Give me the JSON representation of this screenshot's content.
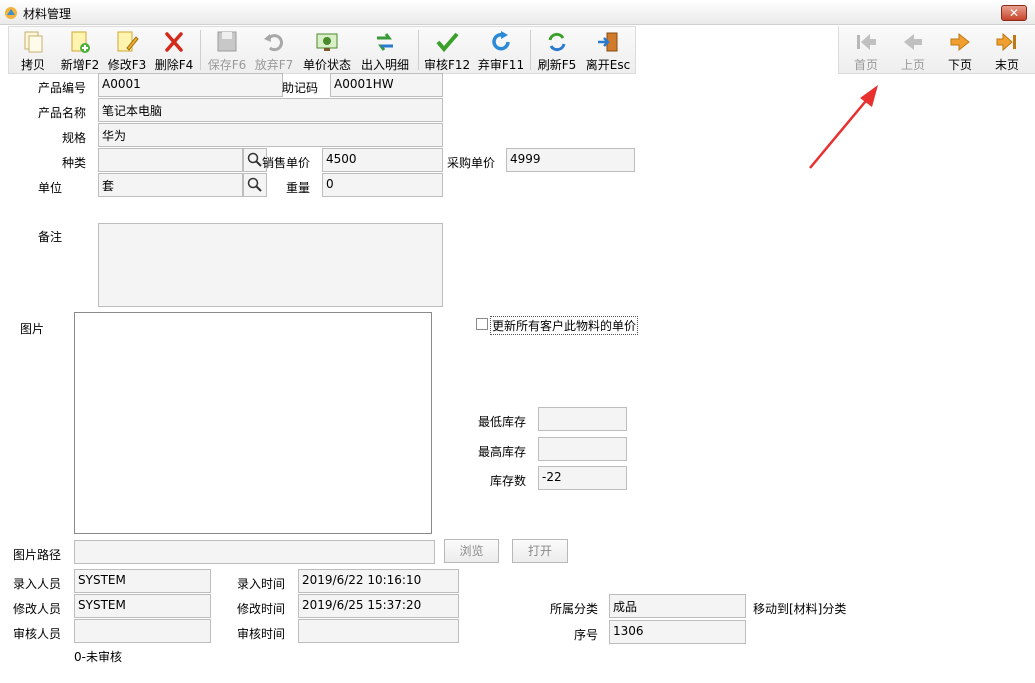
{
  "window": {
    "title": "材料管理",
    "close_label": "✕"
  },
  "toolbar": {
    "copy": "拷贝",
    "new": "新增F2",
    "edit": "修改F3",
    "delete": "删除F4",
    "save": "保存F6",
    "discard": "放弃F7",
    "price_status": "单价状态",
    "io_detail": "出入明细",
    "approve": "审核F12",
    "unapprove": "弃审F11",
    "refresh": "刷新F5",
    "exit": "离开Esc"
  },
  "nav": {
    "first": "首页",
    "prev": "上页",
    "next": "下页",
    "last": "末页"
  },
  "form": {
    "product_code_label": "产品编号",
    "product_code": "A0001",
    "helper_code_label": "助记码",
    "helper_code": "A0001HW",
    "product_name_label": "产品名称",
    "product_name": "笔记本电脑",
    "spec_label": "规格",
    "spec": "华为",
    "category_label": "种类",
    "category": "",
    "sale_price_label": "销售单价",
    "sale_price": "4500",
    "purchase_price_label": "采购单价",
    "purchase_price": "4999",
    "unit_label": "单位",
    "unit": "套",
    "weight_label": "重量",
    "weight": "0",
    "remark_label": "备注",
    "remark": "",
    "image_label": "图片",
    "update_price_checkbox_label": "更新所有客户此物料的单价",
    "min_stock_label": "最低库存",
    "min_stock": "",
    "max_stock_label": "最高库存",
    "max_stock": "",
    "stock_label": "库存数",
    "stock": "-22",
    "image_path_label": "图片路径",
    "image_path": "",
    "browse_button": "浏览",
    "open_button": "打开",
    "creator_label": "录入人员",
    "creator": "SYSTEM",
    "create_time_label": "录入时间",
    "create_time": "2019/6/22 10:16:10",
    "modifier_label": "修改人员",
    "modifier": "SYSTEM",
    "modify_time_label": "修改时间",
    "modify_time": "2019/6/25 15:37:20",
    "category_group_label": "所属分类",
    "category_group": "成品",
    "move_to_link": "移动到[材料]分类",
    "reviewer_label": "审核人员",
    "reviewer": "",
    "review_time_label": "审核时间",
    "review_time": "",
    "sequence_label": "序号",
    "sequence": "1306",
    "status_text": "0-未审核"
  },
  "colors": {
    "accent_arrow": "#e8302e",
    "nav_active": "#f0a030",
    "nav_disabled": "#b8b8b8"
  }
}
